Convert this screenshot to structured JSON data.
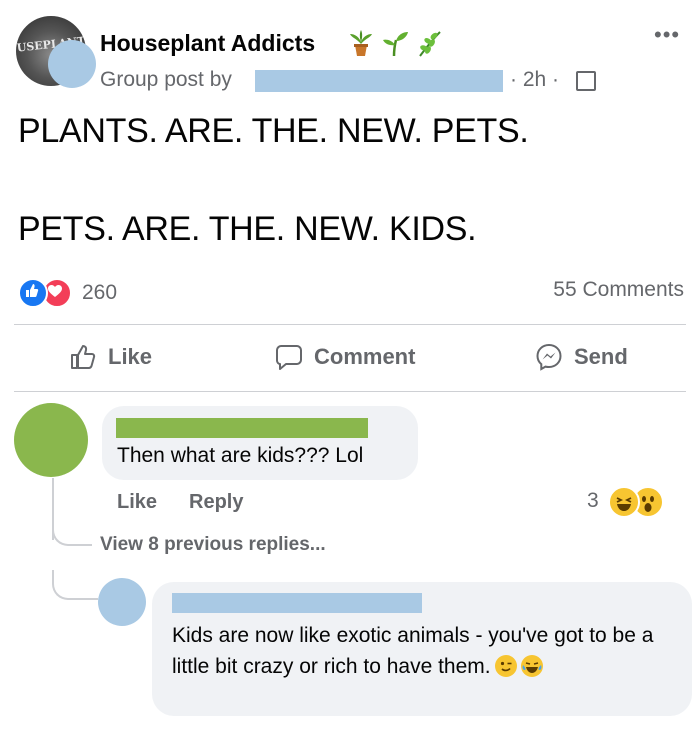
{
  "post": {
    "group_name": "Houseplant Addicts",
    "group_avatar_text": "USEPLANT",
    "group_post_by": "Group post by",
    "time": "· 2h ·",
    "more_label": "•••",
    "text_line1": "PLANTS. ARE. THE. NEW. PETS.",
    "text_line2": "PETS. ARE. THE. NEW. KIDS.",
    "reaction_count": "260",
    "comments_count": "55 Comments"
  },
  "actions": {
    "like": "Like",
    "comment": "Comment",
    "send": "Send"
  },
  "comment1": {
    "text": "Then what are kids??? Lol",
    "like": "Like",
    "reply": "Reply",
    "reaction_count": "3",
    "view_replies": "View 8 previous replies..."
  },
  "comment2": {
    "text": "Kids are now like exotic animals - you've got to be a little bit crazy or rich to have them."
  },
  "colors": {
    "facebook_blue": "#1877f2",
    "love_red": "#f33e58",
    "secondary_text": "#65676b",
    "bubble_bg": "#f0f2f5",
    "redaction_blue": "#a9c9e4",
    "redaction_green": "#8ab74d"
  }
}
